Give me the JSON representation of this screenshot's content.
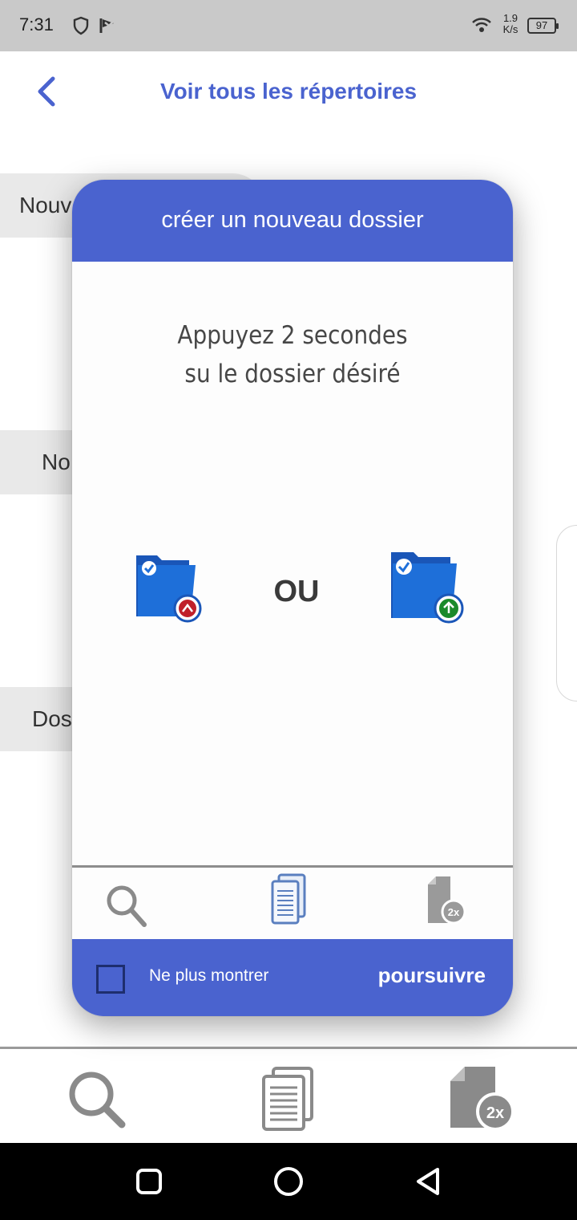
{
  "status_bar": {
    "time": "7:31",
    "network_speed_value": "1.9",
    "network_speed_unit": "K/s",
    "battery": "97",
    "icons": [
      "shield-icon",
      "flag-icon",
      "wifi-icon",
      "battery-icon"
    ]
  },
  "header": {
    "back_icon": "chevron-left-icon",
    "title": "Voir tous les répertoires"
  },
  "background_rows": [
    {
      "label": "Nouv"
    },
    {
      "label": "No"
    },
    {
      "label": "Dos"
    }
  ],
  "modal": {
    "title": "créer un nouveau dossier",
    "instruction_line1": "Appuyez 2 secondes",
    "instruction_line2": "su le dossier désiré",
    "or_text": "OU",
    "left_folder_icon": "folder-delete-icon",
    "right_folder_icon": "folder-add-icon",
    "toolbar_icons": [
      "search-icon",
      "documents-icon",
      "file-2x-icon"
    ],
    "badge_2x": "2x",
    "checkbox_label": "Ne plus montrer",
    "continue_label": "poursuivre"
  },
  "bottom_toolbar": {
    "icons": [
      "search-icon",
      "documents-icon",
      "file-2x-icon"
    ],
    "badge_2x": "2x"
  },
  "nav_bar": {
    "icons": [
      "recents-square-icon",
      "home-circle-icon",
      "back-triangle-icon"
    ]
  },
  "colors": {
    "accent": "#4a63cf",
    "status_bar": "#c9c9c9",
    "nav_bar": "#000000",
    "row_background": "#e9e9e9",
    "folder_blue": "#1e63c4",
    "delete_red": "#c0202a",
    "add_green": "#1a8a2a"
  }
}
